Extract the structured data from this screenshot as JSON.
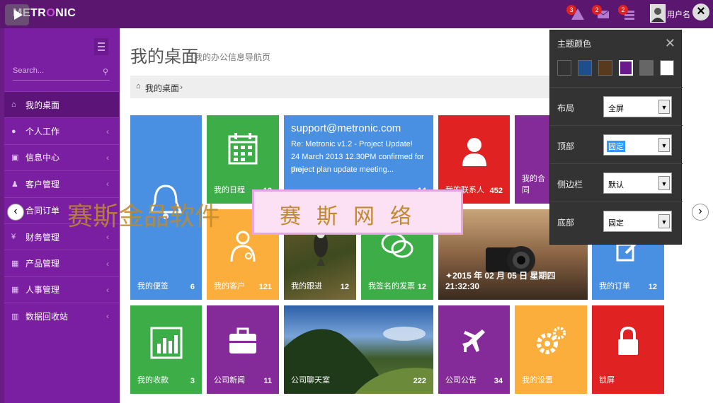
{
  "header": {
    "logo": {
      "a": "ME",
      "b": "TR",
      "c": "O",
      "d": "NIC"
    },
    "badges": [
      "3",
      "2",
      "2"
    ],
    "username": "用户名"
  },
  "sidebar": {
    "search_placeholder": "Search...",
    "items": [
      {
        "label": "我的桌面",
        "icon": "home-icon",
        "active": true
      },
      {
        "label": "个人工作",
        "icon": "user-icon"
      },
      {
        "label": "信息中心",
        "icon": "inbox-icon"
      },
      {
        "label": "客户管理",
        "icon": "person-icon"
      },
      {
        "label": "合同订单",
        "icon": "document-icon"
      },
      {
        "label": "财务管理",
        "icon": "yen-icon"
      },
      {
        "label": "产品管理",
        "icon": "grid-icon"
      },
      {
        "label": "人事管理",
        "icon": "grid-icon"
      },
      {
        "label": "数据回收站",
        "icon": "trash-icon"
      }
    ]
  },
  "page": {
    "title": "我的桌面",
    "subtitle": "我的办公信息导航页",
    "breadcrumb": "我的桌面"
  },
  "tiles": {
    "notes": {
      "label": "我的便签",
      "count": "6",
      "color": "#4a90e2"
    },
    "calendar": {
      "label": "我的日程",
      "count": "12",
      "color": "#3cad47"
    },
    "mail": {
      "email": "support@metronic.com",
      "line1": "Re: Metronic v1.2 - Project Update!",
      "line2": "24 March 2013 12.30PM confirmed for the",
      "line3": "project plan update meeting...",
      "count": "14"
    },
    "contacts": {
      "label": "我的联系人",
      "count": "452",
      "color": "#e02222"
    },
    "contract": {
      "label": "我的合同",
      "color": "#852b99"
    },
    "customers": {
      "label": "我的客户",
      "count": "121",
      "color": "#fbae3c"
    },
    "followup": {
      "label": "我的跟进",
      "count": "12"
    },
    "invoice": {
      "label": "我签名的发票",
      "count": "12",
      "color": "#3cad47"
    },
    "camera": {
      "caption": "2015 年 02 月 05 日 星期四 21:32:30"
    },
    "orders": {
      "label": "我的订单",
      "count": "12",
      "color": "#4a90e2"
    },
    "income": {
      "label": "我的收款",
      "count": "3",
      "color": "#3cad47"
    },
    "news": {
      "label": "公司新闻",
      "count": "11",
      "color": "#852b99"
    },
    "chat": {
      "label": "公司聊天室",
      "count": "222"
    },
    "notice": {
      "label": "公司公告",
      "count": "34",
      "color": "#852b99"
    },
    "settings": {
      "label": "我的设置",
      "color": "#fbae3c"
    },
    "lock": {
      "label": "锁屏",
      "color": "#e02222"
    }
  },
  "theme_panel": {
    "title": "主题颜色",
    "swatches": [
      "#333333",
      "#1f4e8c",
      "#5a3a1c",
      "#6a1a8c",
      "#666666",
      "#ffffff"
    ],
    "rows": [
      {
        "label": "布局",
        "value": "全屏"
      },
      {
        "label": "顶部",
        "value": "固定"
      },
      {
        "label": "侧边栏",
        "value": "默认"
      },
      {
        "label": "底部",
        "value": "固定"
      }
    ]
  },
  "watermark": {
    "text1": "赛斯金品软件",
    "text2": "赛斯网络"
  }
}
